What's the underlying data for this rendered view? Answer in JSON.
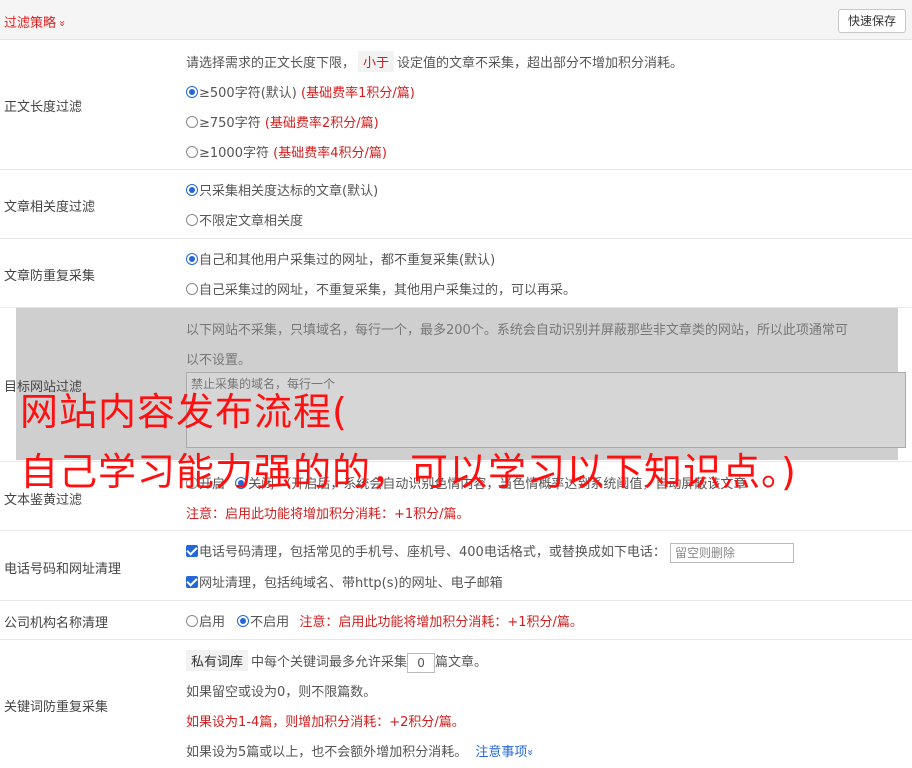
{
  "header": {
    "title": "过滤策略",
    "chevron": "»",
    "save_label": "快速保存"
  },
  "length_filter": {
    "label": "正文长度过滤",
    "desc_before": "请选择需求的正文长度下限，",
    "desc_tag": "小于",
    "desc_after": "设定值的文章不采集，超出部分不增加积分消耗。",
    "options": [
      {
        "text": "≥500字符(默认)",
        "note": "(基础费率1积分/篇)",
        "selected": true
      },
      {
        "text": "≥750字符",
        "note": "(基础费率2积分/篇)",
        "selected": false
      },
      {
        "text": "≥1000字符",
        "note": "(基础费率4积分/篇)",
        "selected": false
      }
    ]
  },
  "relevance_filter": {
    "label": "文章相关度过滤",
    "options": [
      {
        "text": "只采集相关度达标的文章(默认)",
        "selected": true
      },
      {
        "text": "不限定文章相关度",
        "selected": false
      }
    ]
  },
  "dedupe": {
    "label": "文章防重复采集",
    "options": [
      {
        "text": "自己和其他用户采集过的网址，都不重复采集(默认)",
        "selected": true
      },
      {
        "text": "自己采集过的网址，不重复采集，其他用户采集过的，可以再采。",
        "selected": false
      }
    ]
  },
  "site_filter": {
    "label": "目标网站过滤",
    "desc_line1": "以下网站不采集，只填域名，每行一个，最多200个。系统会自动识别并屏蔽那些非文章类的网站，所以此项通常可",
    "desc_line2": "以不设置。",
    "placeholder": "禁止采集的域名，每行一个"
  },
  "porn_filter": {
    "label": "文本鉴黄过滤",
    "opt_on": "开启",
    "opt_off": "关闭",
    "desc": "（开启后，系统会自动识别色情内容，当色情概率达到系统阈值，自动屏蔽该文章",
    "note": "注意：启用此功能将增加积分消耗：+1积分/篇。"
  },
  "phone_filter": {
    "label": "电话号码和网址清理",
    "phone_text": "电话号码清理，包括常见的手机号、座机号、400电话格式，或替换成如下电话：",
    "phone_placeholder": "留空则删除",
    "url_text": "网址清理，包括纯域名、带http(s)的网址、电子邮箱"
  },
  "org_filter": {
    "label": "公司机构名称清理",
    "opt_on": "启用",
    "opt_off": "不启用",
    "note": "注意：启用此功能将增加积分消耗：+1积分/篇。"
  },
  "keyword_dedupe": {
    "label": "关键词防重复采集",
    "tag": "私有词库",
    "line1_before": "中每个关键词最多允许采集",
    "count": "0",
    "line1_after": "篇文章。",
    "line2": "如果留空或设为0，则不限篇数。",
    "line3": "如果设为1-4篇，则增加积分消耗：+2积分/篇。",
    "line4": "如果设为5篇或以上，也不会额外增加积分消耗。",
    "link": "注意事项",
    "link_chevron": "»"
  },
  "overlay": {
    "line1": "网站内容发布流程(",
    "line2": "自己学习能力强的的，可以学习以下知识点。)"
  }
}
